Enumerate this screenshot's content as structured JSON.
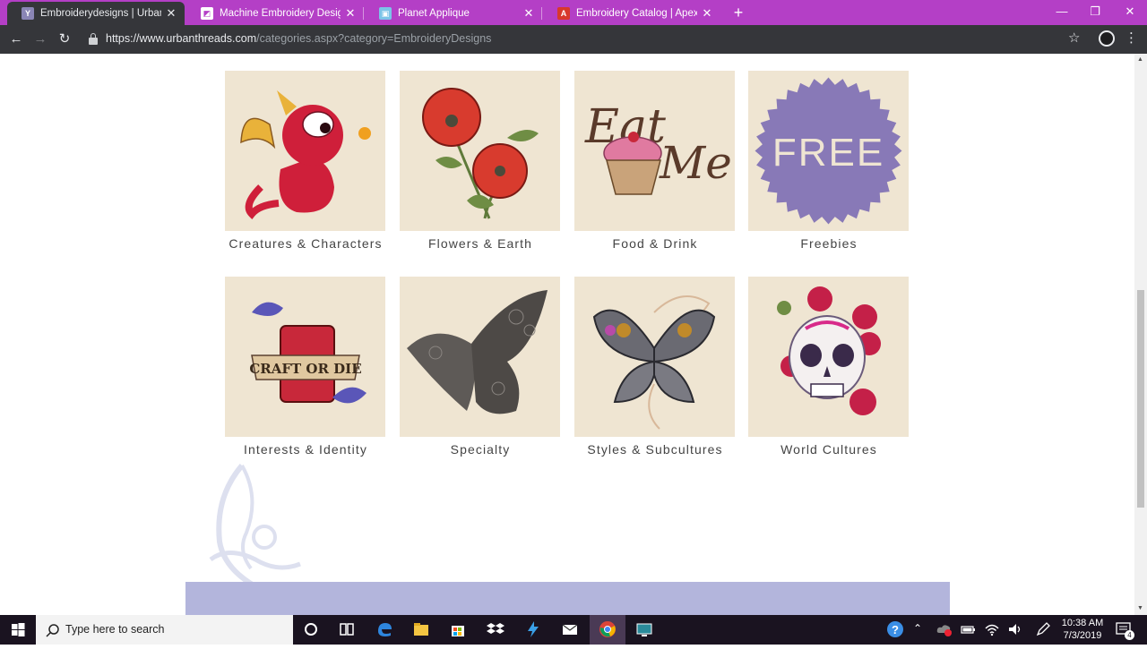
{
  "browser": {
    "tabs": [
      {
        "label": "Embroiderydesigns | Urban Threa",
        "favicon": "urban-threads-icon",
        "active": true
      },
      {
        "label": "Machine Embroidery Designs at E",
        "favicon": "embroidery-designs-icon",
        "active": false
      },
      {
        "label": "Planet Applique",
        "favicon": "planet-applique-icon",
        "active": false
      },
      {
        "label": "Embroidery Catalog | Apex Embr",
        "favicon": "apex-embroidery-icon",
        "active": false
      }
    ],
    "url_host": "https://www.urbanthreads.com",
    "url_path": "/categories.aspx?category=EmbroideryDesigns"
  },
  "categories": [
    {
      "label": "Creatures & Characters",
      "art": "dragon"
    },
    {
      "label": "Flowers & Earth",
      "art": "poppies"
    },
    {
      "label": "Food & Drink",
      "art": "eat-me-cupcake"
    },
    {
      "label": "Freebies",
      "art": "free-badge",
      "badge_text": "FREE"
    },
    {
      "label": "Interests & Identity",
      "art": "craft-or-die",
      "banner_text": "CRAFT OR DIE"
    },
    {
      "label": "Specialty",
      "art": "lace-butterfly"
    },
    {
      "label": "Styles & Subcultures",
      "art": "steampunk-butterfly"
    },
    {
      "label": "World Cultures",
      "art": "sugar-skull"
    }
  ],
  "art_text": {
    "eat": "Eat",
    "me": "Me"
  },
  "taskbar": {
    "search_placeholder": "Type here to search",
    "time": "10:38 AM",
    "date": "7/3/2019",
    "notification_count": "4"
  },
  "colors": {
    "browser_frame": "#b43fc6",
    "toolbar": "#35363a",
    "tile_bg": "#efe5d2",
    "footer_band": "#b3b5dc",
    "free_badge": "#8879b7"
  }
}
